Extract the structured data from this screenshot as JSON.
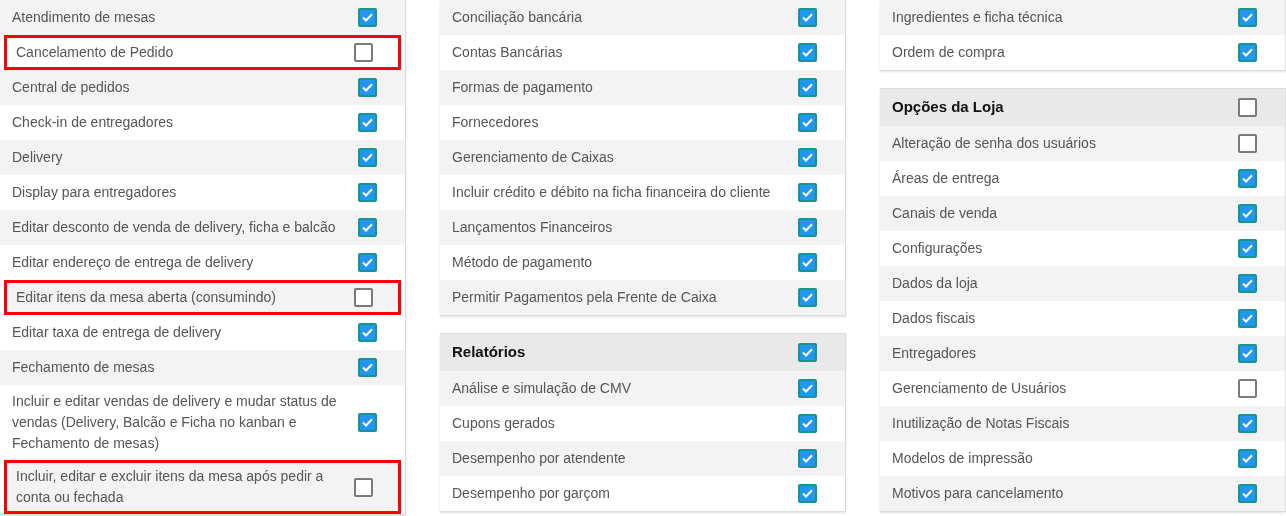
{
  "columns": [
    {
      "panels": [
        {
          "rows": [
            {
              "label": "Atendimento de mesas",
              "checked": true,
              "highlighted": false
            },
            {
              "label": "Cancelamento de Pedido",
              "checked": false,
              "highlighted": true
            },
            {
              "label": "Central de pedidos",
              "checked": true,
              "highlighted": false
            },
            {
              "label": "Check-in de entregadores",
              "checked": true,
              "highlighted": false
            },
            {
              "label": "Delivery",
              "checked": true,
              "highlighted": false
            },
            {
              "label": "Display para entregadores",
              "checked": true,
              "highlighted": false
            },
            {
              "label": "Editar desconto de venda de delivery, ficha e balcão",
              "checked": true,
              "highlighted": false
            },
            {
              "label": "Editar endereço de entrega de delivery",
              "checked": true,
              "highlighted": false
            },
            {
              "label": "Editar itens da mesa aberta (consumindo)",
              "checked": false,
              "highlighted": true
            },
            {
              "label": "Editar taxa de entrega de delivery",
              "checked": true,
              "highlighted": false
            },
            {
              "label": "Fechamento de mesas",
              "checked": true,
              "highlighted": false
            },
            {
              "label": "Incluir e editar vendas de delivery e mudar status de vendas (Delivery, Balcão e Ficha no kanban e Fechamento de mesas)",
              "checked": true,
              "highlighted": false
            },
            {
              "label": "Incluir, editar e excluir itens da mesa após pedir a conta ou fechada",
              "checked": false,
              "highlighted": true
            }
          ]
        }
      ]
    },
    {
      "panels": [
        {
          "rows": [
            {
              "label": "Conciliação bancária",
              "checked": true
            },
            {
              "label": "Contas Bancárias",
              "checked": true
            },
            {
              "label": "Formas de pagamento",
              "checked": true
            },
            {
              "label": "Fornecedores",
              "checked": true
            },
            {
              "label": "Gerenciamento de Caixas",
              "checked": true
            },
            {
              "label": "Incluir crédito e débito na ficha financeira do cliente",
              "checked": true
            },
            {
              "label": "Lançamentos Financeiros",
              "checked": true
            },
            {
              "label": "Método de pagamento",
              "checked": true
            },
            {
              "label": "Permitir Pagamentos pela Frente de Caixa",
              "checked": true
            }
          ]
        },
        {
          "header": {
            "label": "Relatórios",
            "checked": true
          },
          "rows": [
            {
              "label": "Análise e simulação de CMV",
              "checked": true
            },
            {
              "label": "Cupons gerados",
              "checked": true
            },
            {
              "label": "Desempenho por atendente",
              "checked": true
            },
            {
              "label": "Desempenho por garçom",
              "checked": true
            }
          ]
        }
      ]
    },
    {
      "panels": [
        {
          "rows": [
            {
              "label": "Ingredientes e ficha técnica",
              "checked": true
            },
            {
              "label": "Ordem de compra",
              "checked": true
            }
          ]
        },
        {
          "header": {
            "label": "Opções da Loja",
            "checked": false
          },
          "rows": [
            {
              "label": "Alteração de senha dos usuários",
              "checked": false
            },
            {
              "label": "Áreas de entrega",
              "checked": true
            },
            {
              "label": "Canais de venda",
              "checked": true
            },
            {
              "label": "Configurações",
              "checked": true
            },
            {
              "label": "Dados da loja",
              "checked": true
            },
            {
              "label": "Dados fiscais",
              "checked": true
            },
            {
              "label": "Entregadores",
              "checked": true
            },
            {
              "label": "Gerenciamento de Usuários",
              "checked": false
            },
            {
              "label": "Inutilização de Notas Fiscais",
              "checked": true
            },
            {
              "label": "Modelos de impressão",
              "checked": true
            },
            {
              "label": "Motivos para cancelamento",
              "checked": true
            }
          ]
        }
      ]
    }
  ]
}
